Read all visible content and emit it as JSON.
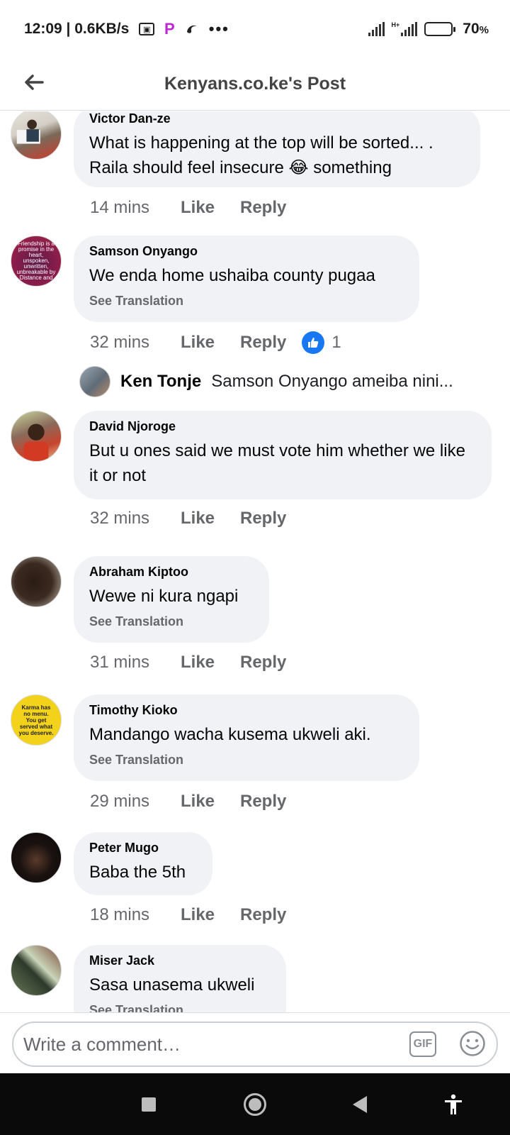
{
  "status_bar": {
    "time_speed": "12:09 | 0.6KB/s",
    "network_type": "H+",
    "battery_percent": "70",
    "battery_symbol": "%",
    "battery_level": 0.7
  },
  "header": {
    "title": "Kenyans.co.ke's Post"
  },
  "comments": [
    {
      "name": "Victor Dan-ze",
      "text": "What is happening at the top will be sorted... . Raila should feel insecure 😂 something",
      "time": "14 mins",
      "like": "Like",
      "reply": "Reply"
    },
    {
      "name": "Samson Onyango",
      "text": "We enda home  ushaiba county pugaa",
      "see_translation": "See Translation",
      "time": "32 mins",
      "like": "Like",
      "reply": "Reply",
      "reaction_count": "1"
    },
    {
      "name": "David Njoroge",
      "text": "But u ones said we must vote him whether we like it or not",
      "time": "32 mins",
      "like": "Like",
      "reply": "Reply"
    },
    {
      "name": "Abraham Kiptoo",
      "text": "Wewe ni kura ngapi",
      "see_translation": "See Translation",
      "time": "31 mins",
      "like": "Like",
      "reply": "Reply"
    },
    {
      "name": "Timothy Kioko",
      "text": "Mandango wacha kusema ukweli aki.",
      "see_translation": "See Translation",
      "time": "29 mins",
      "like": "Like",
      "reply": "Reply"
    },
    {
      "name": "Peter Mugo",
      "text": "Baba the 5th",
      "time": "18 mins",
      "like": "Like",
      "reply": "Reply"
    },
    {
      "name": "Miser Jack",
      "text": "Sasa unasema ukweli",
      "see_translation": "See Translation"
    }
  ],
  "reply_preview": {
    "name": "Ken Tonje",
    "text": "Samson Onyango ameiba nini..."
  },
  "avatar_texts": {
    "samson": "Friendship is a promise in the heart, unspoken, unwritten, unbreakable by Distance and",
    "timothy": "Karma has no menu. You get served what you deserve."
  },
  "composer": {
    "placeholder": "Write a comment…",
    "gif_label": "GIF"
  },
  "colors": {
    "bubble": "#f0f2f5",
    "meta_text": "#65676b",
    "like_blue": "#1877f2",
    "nav_bar": "#0a0a0a"
  }
}
